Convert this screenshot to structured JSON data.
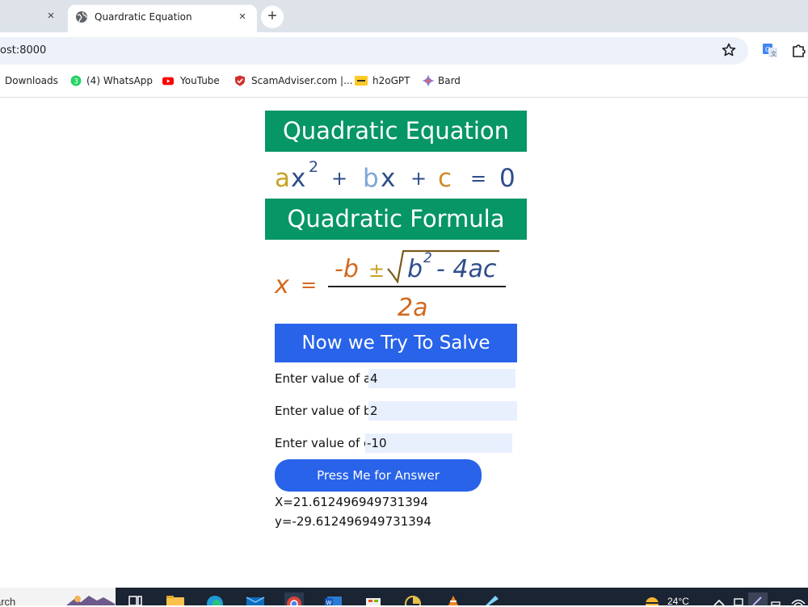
{
  "browser": {
    "inactive_tab_close": "×",
    "active_tab": {
      "title": "Quardratic Equation",
      "close": "×"
    },
    "new_tab": "+",
    "url": "ost:8000",
    "bookmarks": [
      {
        "label": "Downloads",
        "icon": "download-icon"
      },
      {
        "label": "(4) WhatsApp",
        "icon": "whatsapp-icon",
        "badge": "3"
      },
      {
        "label": "YouTube",
        "icon": "youtube-icon"
      },
      {
        "label": "ScamAdviser.com |...",
        "icon": "scamadviser-icon"
      },
      {
        "label": "h2oGPT",
        "icon": "h2ogpt-icon"
      },
      {
        "label": "Bard",
        "icon": "bard-icon"
      }
    ]
  },
  "page": {
    "heading_equation": "Quadratic Equation",
    "equation": {
      "a": "a",
      "x": "x",
      "exp": "2",
      "plus": "+",
      "b": "b",
      "c": "c",
      "eq": "=",
      "zero": "0"
    },
    "heading_formula": "Quadratic Formula",
    "formula": {
      "x": "x",
      "eq": "=",
      "neg_b": "-b",
      "pm": "±",
      "b2": "b",
      "exp": "2",
      "minus_4ac": "- 4ac",
      "denominator": "2a"
    },
    "heading_solve": "Now we Try To Salve",
    "inputs": [
      {
        "label": "Enter value of a:",
        "value": "4"
      },
      {
        "label": "Enter value of b:",
        "value": "2"
      },
      {
        "label": "Enter value of c",
        "value": "-10"
      }
    ],
    "button": "Press Me for Answer",
    "result_x": "X=21.612496949731394",
    "result_y": "y=-29.612496949731394"
  },
  "colors": {
    "green_header": "#079666",
    "blue": "#2863e9",
    "coef_a": "#c9a227",
    "coef_b": "#7ea6d8",
    "coef_c": "#d08a2a",
    "dark_blue": "#2e4d8a",
    "orange": "#d2691e"
  },
  "taskbar": {
    "search_text": "arch",
    "temperature": "24°C"
  }
}
